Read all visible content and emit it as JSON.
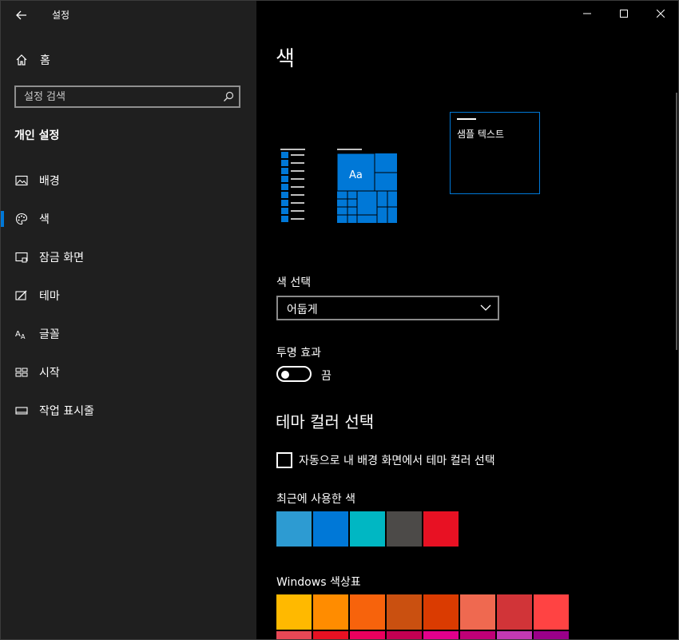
{
  "window": {
    "title": "설정"
  },
  "sidebar": {
    "home_label": "홈",
    "search_placeholder": "설정 검색",
    "section_title": "개인 설정",
    "items": [
      {
        "label": "배경",
        "icon": "picture-icon"
      },
      {
        "label": "색",
        "icon": "palette-icon",
        "selected": true
      },
      {
        "label": "잠금 화면",
        "icon": "lock-screen-icon"
      },
      {
        "label": "테마",
        "icon": "theme-icon"
      },
      {
        "label": "글꼴",
        "icon": "font-icon"
      },
      {
        "label": "시작",
        "icon": "start-icon"
      },
      {
        "label": "작업 표시줄",
        "icon": "taskbar-icon"
      }
    ]
  },
  "main": {
    "title": "색",
    "preview_sample_text": "샘플 텍스트",
    "preview_tile_text": "Aa",
    "color_select_label": "색 선택",
    "color_select_value": "어둡게",
    "transparency_label": "투명 효과",
    "transparency_state": "끔",
    "accent_heading": "테마 컬러 선택",
    "auto_accent_label": "자동으로 내 배경 화면에서 테마 컬러 선택",
    "auto_accent_checked": false,
    "recent_label": "최근에 사용한 색",
    "recent_colors": [
      "#2d9bd2",
      "#0078d7",
      "#00b7c3",
      "#4c4a48",
      "#e81123"
    ],
    "palette_label": "Windows 색상표",
    "palette_row1": [
      "#ffb900",
      "#ff8c00",
      "#f7630c",
      "#ca5010",
      "#da3b01",
      "#ef6950",
      "#d13438",
      "#ff4343"
    ],
    "palette_row2": [
      "#e74856",
      "#e81123",
      "#ea005e",
      "#c30052",
      "#e3008c",
      "#bf0077",
      "#c239b3",
      "#9a0089"
    ]
  },
  "colors": {
    "accent": "#0078d7",
    "sidebar_bg": "#1f1f1f",
    "main_bg": "#000000"
  }
}
